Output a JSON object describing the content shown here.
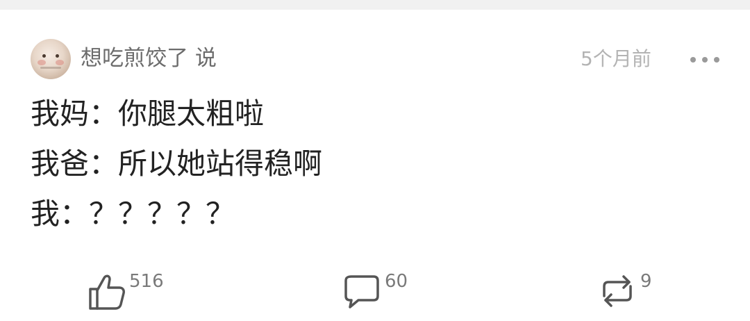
{
  "comment": {
    "username": "想吃煎饺了 说",
    "timestamp": "5个月前",
    "lines": [
      "我妈：你腿太粗啦",
      "我爸：所以她站得稳啊",
      "我：？？？？？"
    ]
  },
  "actions": {
    "like_count": "516",
    "comment_count": "60",
    "repost_count": "9"
  },
  "icons": {
    "avatar": "avatar-image",
    "more": "more-icon",
    "like": "thumbs-up-icon",
    "comment": "comment-bubble-icon",
    "repost": "repost-icon"
  }
}
